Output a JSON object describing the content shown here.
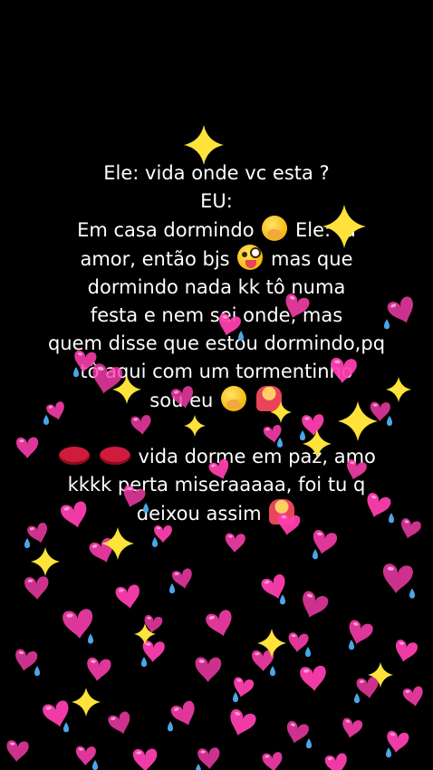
{
  "caption": {
    "lines": [
      "Ele: vida onde vc esta ?",
      "EU:",
      "Em casa dormindo",
      "Ele: tá",
      "amor, então bjs",
      "mas que",
      "dormindo nada kk tô numa",
      "festa e nem sei onde, mas",
      "quem disse que estou dormindo,pq",
      "tô aqui com um tormentinho",
      "sou eu",
      "vida dorme em paz, amo",
      "kkkk perta miseraaaaa, foi tu q",
      "deixou assim"
    ],
    "emoji": {
      "giggle": "face-with-hand-over-mouth-emoji",
      "tongue": "winking-face-with-tongue-emoji",
      "shrug": "person-shrugging-emoji",
      "lips": "kiss-mark-emoji"
    }
  },
  "overlay": {
    "heart_color": "#ff3fb0",
    "heart_highlight": "#ff9ad6",
    "drop_color": "#4aa6e8",
    "sparkle_color": "#ffe23a"
  }
}
